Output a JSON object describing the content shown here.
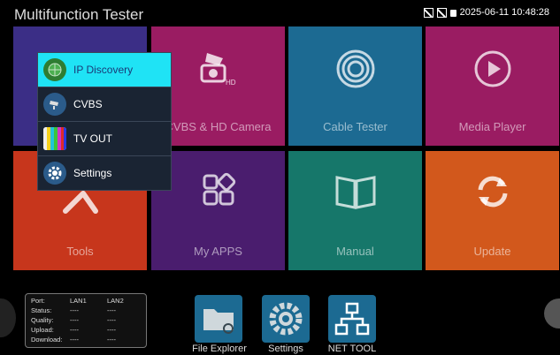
{
  "app": {
    "title": "Multifunction Tester"
  },
  "status": {
    "datetime": "2025-06-11 10:48:28"
  },
  "tiles": [
    {
      "name": "tile-ip-camera",
      "label": "",
      "color": "#3b2e86"
    },
    {
      "name": "tile-cvbs-hd-camera",
      "label": "CVBS & HD Camera",
      "color": "#9a1c62"
    },
    {
      "name": "tile-cable-tester",
      "label": "Cable Tester",
      "color": "#1c6a92"
    },
    {
      "name": "tile-media-player",
      "label": "Media Player",
      "color": "#9a1c62"
    },
    {
      "name": "tile-tools",
      "label": "Tools",
      "color": "#c7361c"
    },
    {
      "name": "tile-my-apps",
      "label": "My APPS",
      "color": "#4a1d6e"
    },
    {
      "name": "tile-manual",
      "label": "Manual",
      "color": "#16776a"
    },
    {
      "name": "tile-update",
      "label": "Update",
      "color": "#d2581c"
    }
  ],
  "popup_menu": {
    "items": [
      {
        "label": "IP Discovery",
        "icon": "globe-icon",
        "active": true
      },
      {
        "label": "CVBS",
        "icon": "camera-icon",
        "active": false
      },
      {
        "label": "TV OUT",
        "icon": "color-bars-icon",
        "active": false
      },
      {
        "label": "Settings",
        "icon": "gear-icon",
        "active": false
      }
    ]
  },
  "lan_status": {
    "headers": [
      "Port:",
      "LAN1",
      "LAN2"
    ],
    "rows": [
      {
        "label": "Status:",
        "lan1": "----",
        "lan2": "----"
      },
      {
        "label": "Quality:",
        "lan1": "----",
        "lan2": "----"
      },
      {
        "label": "Upload:",
        "lan1": "----",
        "lan2": "----"
      },
      {
        "label": "Download:",
        "lan1": "----",
        "lan2": "----"
      }
    ]
  },
  "dock": [
    {
      "label": "File Explorer",
      "icon": "folder-icon"
    },
    {
      "label": "Settings",
      "icon": "gear-icon"
    },
    {
      "label": "NET TOOL",
      "icon": "network-icon"
    }
  ]
}
